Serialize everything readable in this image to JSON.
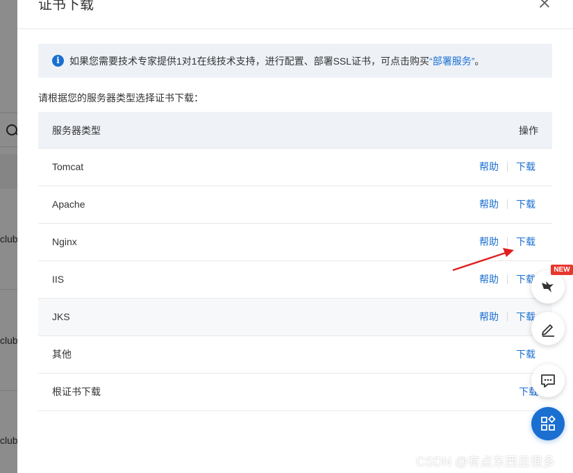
{
  "background": {
    "texts": [
      {
        "text": "club."
      },
      {
        "text": "club"
      },
      {
        "text": "club"
      }
    ]
  },
  "dialog": {
    "title": "证书下载",
    "notice": {
      "prefix": "如果您需要技术专家提供1对1在线技术支持，进行配置、部署SSL证书，可点击购买",
      "link": "“部署服务”",
      "suffix": "。"
    },
    "prompt": "请根据您的服务器类型选择证书下载：",
    "table": {
      "header_type": "服务器类型",
      "header_op": "操作",
      "rows": [
        {
          "name": "Tomcat",
          "help": "帮助",
          "download": "下载"
        },
        {
          "name": "Apache",
          "help": "帮助",
          "download": "下载"
        },
        {
          "name": "Nginx",
          "help": "帮助",
          "download": "下载"
        },
        {
          "name": "IIS",
          "help": "帮助",
          "download": "下载"
        },
        {
          "name": "JKS",
          "help": "帮助",
          "download": "下载"
        },
        {
          "name": "其他",
          "download": "下载"
        },
        {
          "name": "根证书下载",
          "download": "下载"
        }
      ]
    }
  },
  "floating": {
    "new_badge": "NEW",
    "icons": [
      "bird-icon",
      "edit-icon",
      "chat-icon",
      "apps-icon"
    ]
  },
  "watermark": "CSDN @有点东西且很多",
  "colors": {
    "link": "#1a6fd1",
    "notice_bg": "#eef2f7",
    "header_bg": "#eff2f7",
    "badge": "#e8382e",
    "arrow": "#e02020"
  }
}
